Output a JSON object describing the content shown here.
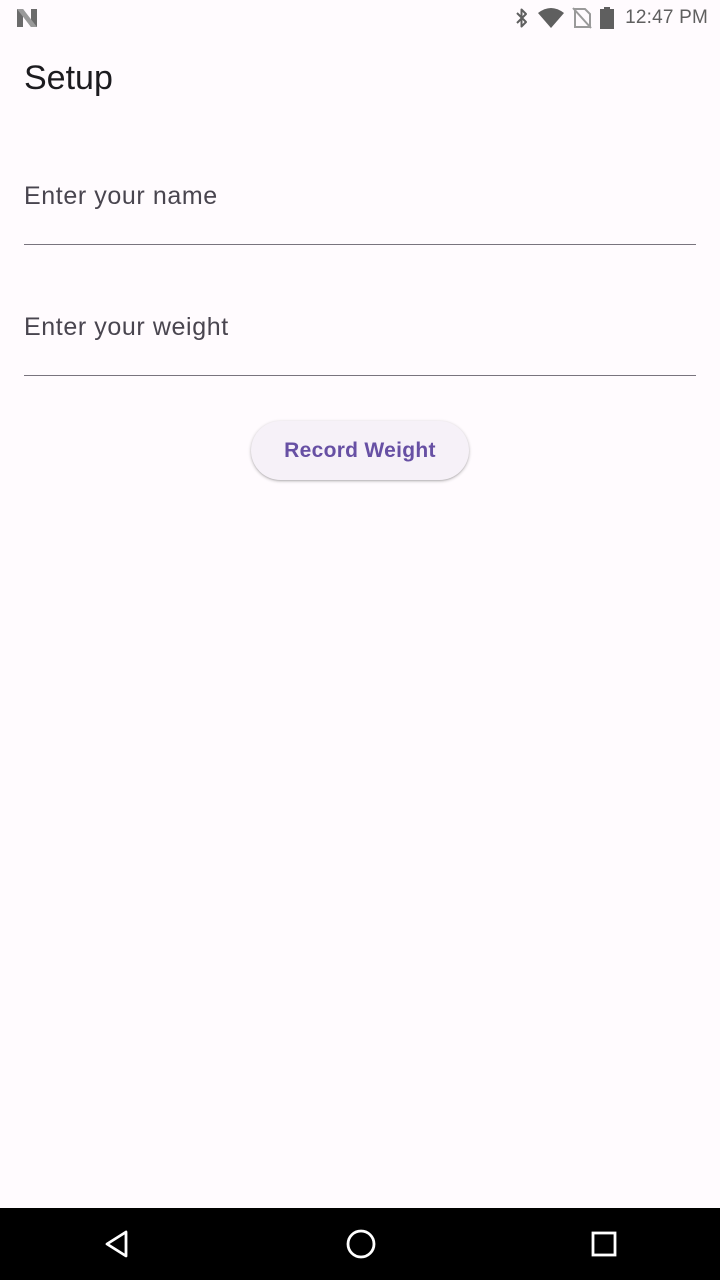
{
  "status_bar": {
    "time": "12:47 PM",
    "icons": [
      "notification-n-icon",
      "bluetooth-icon",
      "wifi-icon",
      "no-sim-icon",
      "battery-icon"
    ]
  },
  "page": {
    "title": "Setup"
  },
  "form": {
    "name_placeholder": "Enter your name",
    "name_value": "",
    "weight_placeholder": "Enter your weight",
    "weight_value": "",
    "record_button_label": "Record Weight"
  },
  "nav_bar": {
    "icons": [
      "back-icon",
      "home-icon",
      "recents-icon"
    ]
  },
  "colors": {
    "background": "#fffbfe",
    "accent": "#6750a4",
    "button_surface": "#f6f1f8",
    "underline": "#79747e",
    "nav_bar": "#000000"
  }
}
